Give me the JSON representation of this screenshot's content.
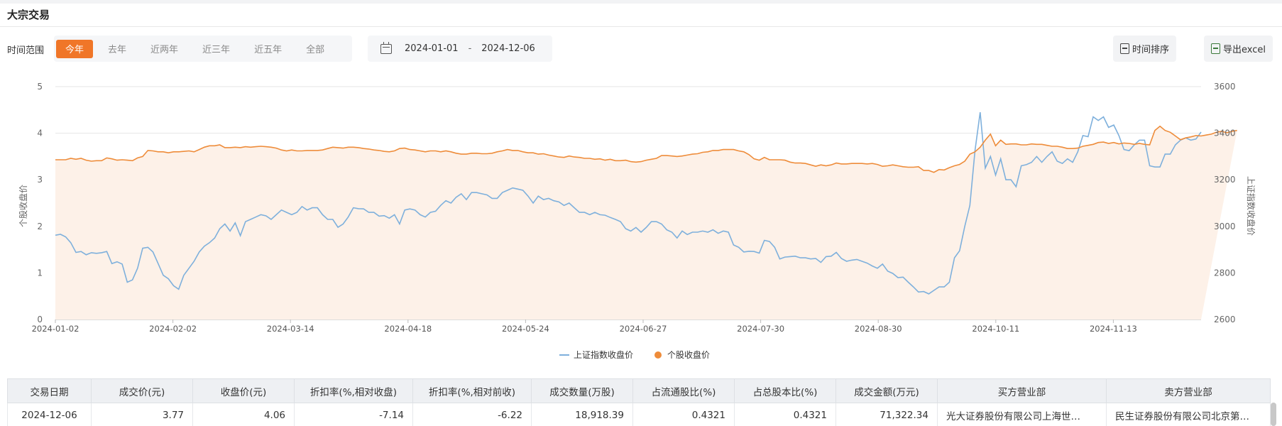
{
  "section": {
    "title": "大宗交易"
  },
  "time_range": {
    "label": "时间范围",
    "options": [
      "今年",
      "去年",
      "近两年",
      "近三年",
      "近五年",
      "全部"
    ],
    "active_index": 0
  },
  "date_range": {
    "start": "2024-01-01",
    "separator": "-",
    "end": "2024-12-06"
  },
  "toolbar": {
    "sort_label": "时间排序",
    "export_label": "导出excel"
  },
  "colors": {
    "accent": "#f07628",
    "index_line": "#7eb0dc",
    "stock_line": "#ee8c3a",
    "area_fill": "#fdf1e8"
  },
  "chart_data": {
    "type": "line",
    "x_ticks": [
      "2024-01-02",
      "2024-02-02",
      "2024-03-14",
      "2024-04-18",
      "2024-05-24",
      "2024-06-27",
      "2024-07-30",
      "2024-08-30",
      "2024-10-11",
      "2024-11-13"
    ],
    "y_left": {
      "label": "个股收盘价",
      "ticks": [
        0,
        1,
        2,
        3,
        4,
        5
      ],
      "ylim": [
        0,
        5
      ]
    },
    "y_right": {
      "label": "上证指数收盘价",
      "ticks": [
        2600,
        2800,
        3000,
        3200,
        3400,
        3600
      ],
      "ylim": [
        2600,
        3600
      ]
    },
    "grid": true,
    "legend_position": "bottom-center",
    "series": [
      {
        "name": "上证指数收盘价",
        "axis": "right",
        "values": [
          2962,
          2966,
          2955,
          2930,
          2888,
          2892,
          2878,
          2887,
          2884,
          2887,
          2892,
          2840,
          2848,
          2838,
          2760,
          2770,
          2820,
          2906,
          2910,
          2890,
          2840,
          2790,
          2775,
          2745,
          2730,
          2790,
          2820,
          2850,
          2890,
          2915,
          2930,
          2950,
          2990,
          3010,
          2980,
          3015,
          2960,
          3020,
          3030,
          3040,
          3050,
          3045,
          3030,
          3050,
          3070,
          3060,
          3050,
          3060,
          3085,
          3070,
          3080,
          3080,
          3050,
          3030,
          3030,
          2996,
          3010,
          3040,
          3080,
          3076,
          3075,
          3060,
          3060,
          3044,
          3046,
          3035,
          3050,
          3010,
          3070,
          3075,
          3070,
          3050,
          3040,
          3060,
          3065,
          3090,
          3110,
          3100,
          3125,
          3140,
          3115,
          3145,
          3145,
          3140,
          3135,
          3120,
          3120,
          3145,
          3155,
          3165,
          3160,
          3155,
          3130,
          3100,
          3130,
          3115,
          3120,
          3110,
          3105,
          3090,
          3100,
          3080,
          3060,
          3060,
          3050,
          3060,
          3050,
          3048,
          3038,
          3030,
          3020,
          2990,
          2980,
          2995,
          2975,
          2995,
          3020,
          3020,
          3010,
          2985,
          2975,
          2950,
          2980,
          2965,
          2975,
          2975,
          2980,
          2975,
          2985,
          2970,
          2980,
          2975,
          2920,
          2910,
          2890,
          2893,
          2892,
          2885,
          2940,
          2935,
          2910,
          2860,
          2868,
          2870,
          2872,
          2865,
          2865,
          2860,
          2862,
          2845,
          2870,
          2872,
          2888,
          2862,
          2850,
          2855,
          2858,
          2850,
          2842,
          2830,
          2820,
          2838,
          2808,
          2798,
          2780,
          2782,
          2760,
          2740,
          2718,
          2720,
          2710,
          2725,
          2740,
          2740,
          2760,
          2865,
          2895,
          3000,
          3090,
          3325,
          3490,
          3250,
          3300,
          3220,
          3290,
          3200,
          3200,
          3170,
          3260,
          3265,
          3275,
          3300,
          3275,
          3300,
          3320,
          3280,
          3270,
          3290,
          3275,
          3320,
          3390,
          3385,
          3470,
          3455,
          3470,
          3425,
          3435,
          3390,
          3330,
          3325,
          3350,
          3370,
          3370,
          3260,
          3255,
          3255,
          3310,
          3310,
          3350,
          3370,
          3380,
          3370,
          3375,
          3405
        ]
      },
      {
        "name": "个股收盘价",
        "axis": "left",
        "values": [
          3.43,
          3.43,
          3.43,
          3.46,
          3.44,
          3.46,
          3.42,
          3.4,
          3.41,
          3.41,
          3.47,
          3.45,
          3.42,
          3.43,
          3.42,
          3.41,
          3.47,
          3.5,
          3.63,
          3.62,
          3.6,
          3.6,
          3.58,
          3.6,
          3.6,
          3.61,
          3.62,
          3.6,
          3.65,
          3.7,
          3.73,
          3.73,
          3.75,
          3.69,
          3.69,
          3.7,
          3.69,
          3.71,
          3.7,
          3.71,
          3.72,
          3.71,
          3.7,
          3.68,
          3.64,
          3.62,
          3.64,
          3.62,
          3.62,
          3.63,
          3.63,
          3.63,
          3.64,
          3.67,
          3.7,
          3.69,
          3.68,
          3.7,
          3.7,
          3.69,
          3.67,
          3.66,
          3.64,
          3.63,
          3.61,
          3.6,
          3.62,
          3.67,
          3.68,
          3.65,
          3.64,
          3.62,
          3.6,
          3.62,
          3.62,
          3.6,
          3.62,
          3.6,
          3.57,
          3.55,
          3.55,
          3.57,
          3.57,
          3.56,
          3.56,
          3.57,
          3.6,
          3.62,
          3.65,
          3.63,
          3.63,
          3.6,
          3.58,
          3.58,
          3.55,
          3.56,
          3.53,
          3.51,
          3.49,
          3.48,
          3.51,
          3.49,
          3.48,
          3.46,
          3.46,
          3.44,
          3.45,
          3.42,
          3.44,
          3.41,
          3.41,
          3.42,
          3.39,
          3.38,
          3.39,
          3.42,
          3.44,
          3.46,
          3.52,
          3.52,
          3.51,
          3.5,
          3.51,
          3.53,
          3.55,
          3.56,
          3.59,
          3.6,
          3.63,
          3.63,
          3.65,
          3.65,
          3.65,
          3.62,
          3.6,
          3.54,
          3.45,
          3.42,
          3.48,
          3.43,
          3.43,
          3.43,
          3.42,
          3.38,
          3.36,
          3.36,
          3.35,
          3.32,
          3.29,
          3.32,
          3.3,
          3.32,
          3.36,
          3.34,
          3.34,
          3.35,
          3.35,
          3.35,
          3.34,
          3.35,
          3.33,
          3.29,
          3.3,
          3.32,
          3.3,
          3.28,
          3.27,
          3.27,
          3.28,
          3.2,
          3.2,
          3.16,
          3.22,
          3.21,
          3.26,
          3.3,
          3.33,
          3.4,
          3.55,
          3.6,
          3.7,
          3.85,
          3.98,
          3.73,
          3.85,
          3.76,
          3.77,
          3.77,
          3.75,
          3.75,
          3.77,
          3.76,
          3.76,
          3.74,
          3.72,
          3.72,
          3.7,
          3.67,
          3.67,
          3.68,
          3.72,
          3.74,
          3.76,
          3.8,
          3.81,
          3.78,
          3.8,
          3.77,
          3.79,
          3.78,
          3.76,
          3.78,
          3.76,
          3.75,
          4.06,
          4.15,
          4.06,
          4.02,
          3.94,
          3.86,
          3.9,
          3.92,
          3.95,
          3.94,
          3.96,
          3.98,
          4.02,
          4.04,
          4.01,
          4.04,
          4.06
        ]
      }
    ]
  },
  "table": {
    "headers": [
      "交易日期",
      "成交价(元)",
      "收盘价(元)",
      "折扣率(%,相对收盘)",
      "折扣率(%,相对前收)",
      "成交数量(万股)",
      "占流通股比(%)",
      "占总股本比(%)",
      "成交金额(万元)",
      "买方营业部",
      "卖方营业部"
    ],
    "rows": [
      [
        "2024-12-06",
        "3.77",
        "4.06",
        "-7.14",
        "-6.22",
        "18,918.39",
        "0.4321",
        "0.4321",
        "71,322.34",
        "光大证券股份有限公司上海世…",
        "民生证券股份有限公司北京第…"
      ]
    ]
  }
}
